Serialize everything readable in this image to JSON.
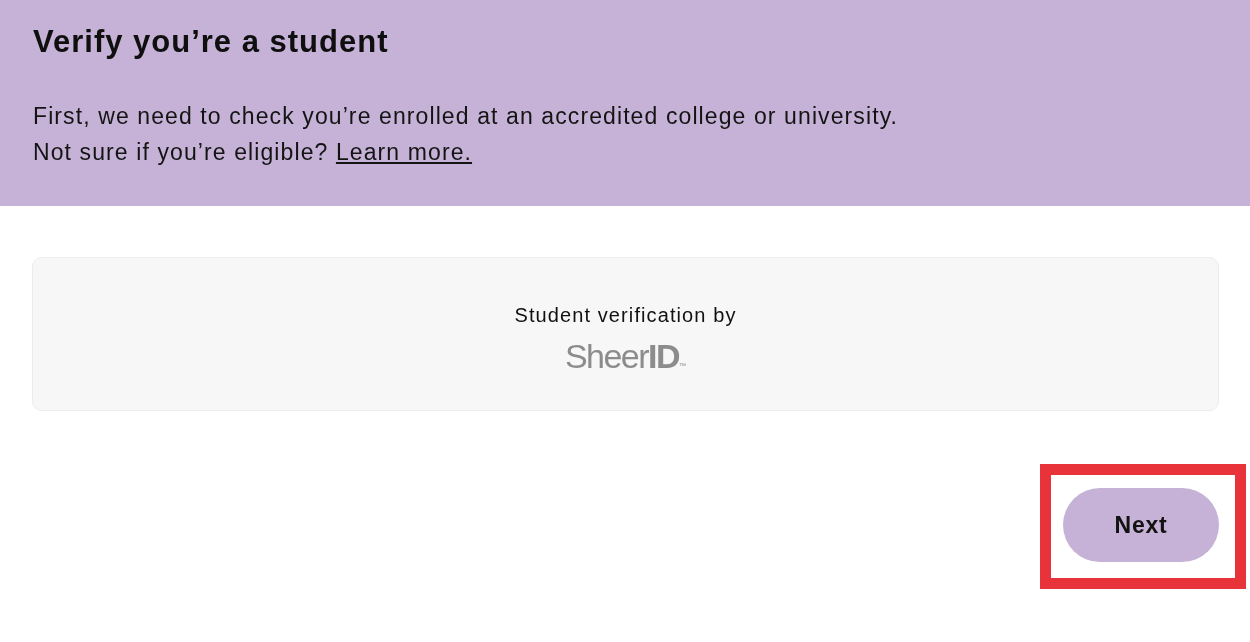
{
  "header": {
    "title": "Verify you’re a student",
    "intro": "First, we need to check you’re enrolled at an accredited college or university.",
    "eligibility": {
      "text": "Not sure if you’re eligible?",
      "link": "Learn more."
    }
  },
  "verification_card": {
    "label": "Student verification by",
    "logo": "Sheer**ID**$_{™}$"
  },
  "next_button": {
    "label": "Next",
    "highlighted": true
  }
}
